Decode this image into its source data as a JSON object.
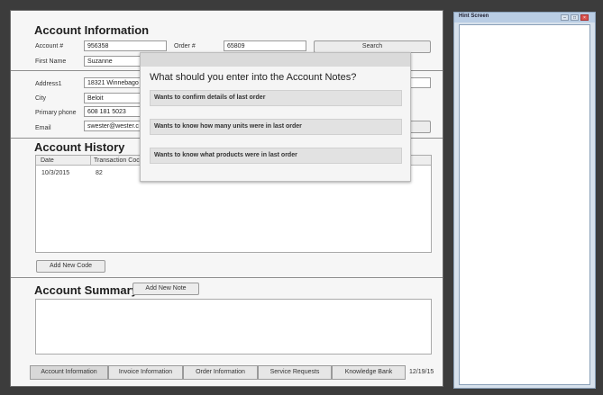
{
  "account_info": {
    "title": "Account Information",
    "account_label": "Account #",
    "account_value": "956358",
    "order_label": "Order #",
    "order_value": "65809",
    "search_label": "Search",
    "first_name_label": "First Name",
    "first_name_value": "Suzanne",
    "address_label": "Address1",
    "address_value": "18321 Winnebago",
    "city_label": "City",
    "city_value": "Beloit",
    "phone_label": "Primary phone",
    "phone_value": "608 181 5023",
    "email_label": "Email",
    "email_value": "swester@wester.c"
  },
  "popup": {
    "question": "What should you enter into the Account Notes?",
    "options": [
      "Wants to confirm details of last order",
      "Wants to know how many units were in last order",
      "Wants to know what products were in last order"
    ]
  },
  "history": {
    "title": "Account History",
    "columns": [
      "Date",
      "Transaction Coc"
    ],
    "rows": [
      {
        "date": "10/3/2015",
        "code": "82"
      }
    ],
    "add_button": "Add New Code"
  },
  "summary": {
    "title": "Account Summary",
    "add_button": "Add New Note"
  },
  "tabs": [
    "Account Information",
    "Invoice Information",
    "Order Information",
    "Service Requests",
    "Knowledge Bank"
  ],
  "date": "12/19/15",
  "hint": {
    "title": "Hint Screen"
  },
  "colors": {
    "background": "#3c3c3c",
    "form": "#f6f6f6",
    "hint_title": "#b9cde4"
  }
}
